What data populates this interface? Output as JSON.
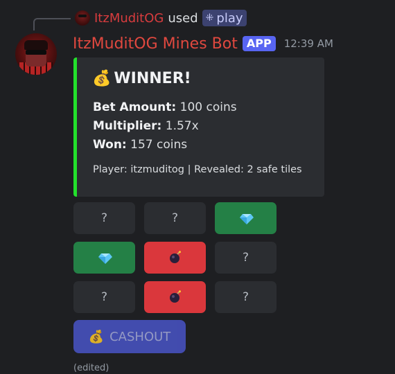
{
  "interaction": {
    "user": "ItzMuditOG",
    "used_word": "used",
    "command": "play"
  },
  "message": {
    "author": "ItzMuditOG Mines Bot",
    "badge": "APP",
    "timestamp": "12:39 AM",
    "edited": "(edited)"
  },
  "embed": {
    "accent_color": "#23e02c",
    "title": "WINNER!",
    "title_icon": "money-bag-icon",
    "fields": [
      {
        "label": "Bet Amount:",
        "value": "100 coins"
      },
      {
        "label": "Multiplier:",
        "value": "1.57x"
      },
      {
        "label": "Won:",
        "value": "157 coins"
      }
    ],
    "footer": "Player: itzmuditog | Revealed: 2 safe tiles"
  },
  "grid": {
    "rows": [
      [
        {
          "state": "hidden",
          "label": "?"
        },
        {
          "state": "hidden",
          "label": "?"
        },
        {
          "state": "safe",
          "icon": "diamond-icon"
        }
      ],
      [
        {
          "state": "safe",
          "icon": "diamond-icon"
        },
        {
          "state": "bomb",
          "icon": "bomb-icon"
        },
        {
          "state": "hidden",
          "label": "?"
        }
      ],
      [
        {
          "state": "hidden",
          "label": "?"
        },
        {
          "state": "bomb",
          "icon": "bomb-icon"
        },
        {
          "state": "hidden",
          "label": "?"
        }
      ]
    ]
  },
  "cashout": {
    "label": "CASHOUT",
    "icon": "money-bag-icon"
  },
  "colors": {
    "safe": "#248046",
    "bomb": "#da373c",
    "hidden": "#2b2d31",
    "brand": "#5865f2"
  }
}
